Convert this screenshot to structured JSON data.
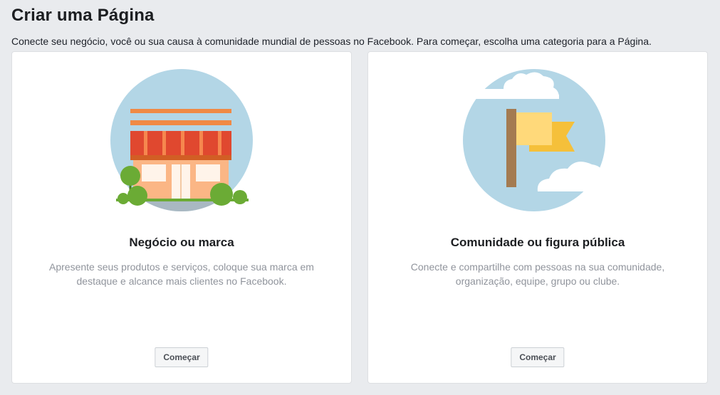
{
  "header": {
    "title": "Criar uma Página",
    "subtitle": "Conecte seu negócio, você ou sua causa à comunidade mundial de pessoas no Facebook. Para começar, escolha uma categoria para a Página."
  },
  "cards": [
    {
      "title": "Negócio ou marca",
      "description": "Apresente seus produtos e serviços, coloque sua marca em destaque e alcance mais clientes no Facebook.",
      "button_label": "Começar",
      "icon": "storefront-icon"
    },
    {
      "title": "Comunidade ou figura pública",
      "description": "Conecte e compartilhe com pessoas na sua comunidade, organização, equipe, grupo ou clube.",
      "button_label": "Começar",
      "icon": "flag-icon"
    }
  ],
  "colors": {
    "background": "#e9ebee",
    "card": "#ffffff",
    "sky": "#b3d6e6",
    "awning_red": "#e0482f",
    "store_body": "#fbb685",
    "bush_green": "#6bab35",
    "flag_yellow": "#ffd97a",
    "flag_gold": "#f5c03a",
    "pole_brown": "#a47b51"
  }
}
